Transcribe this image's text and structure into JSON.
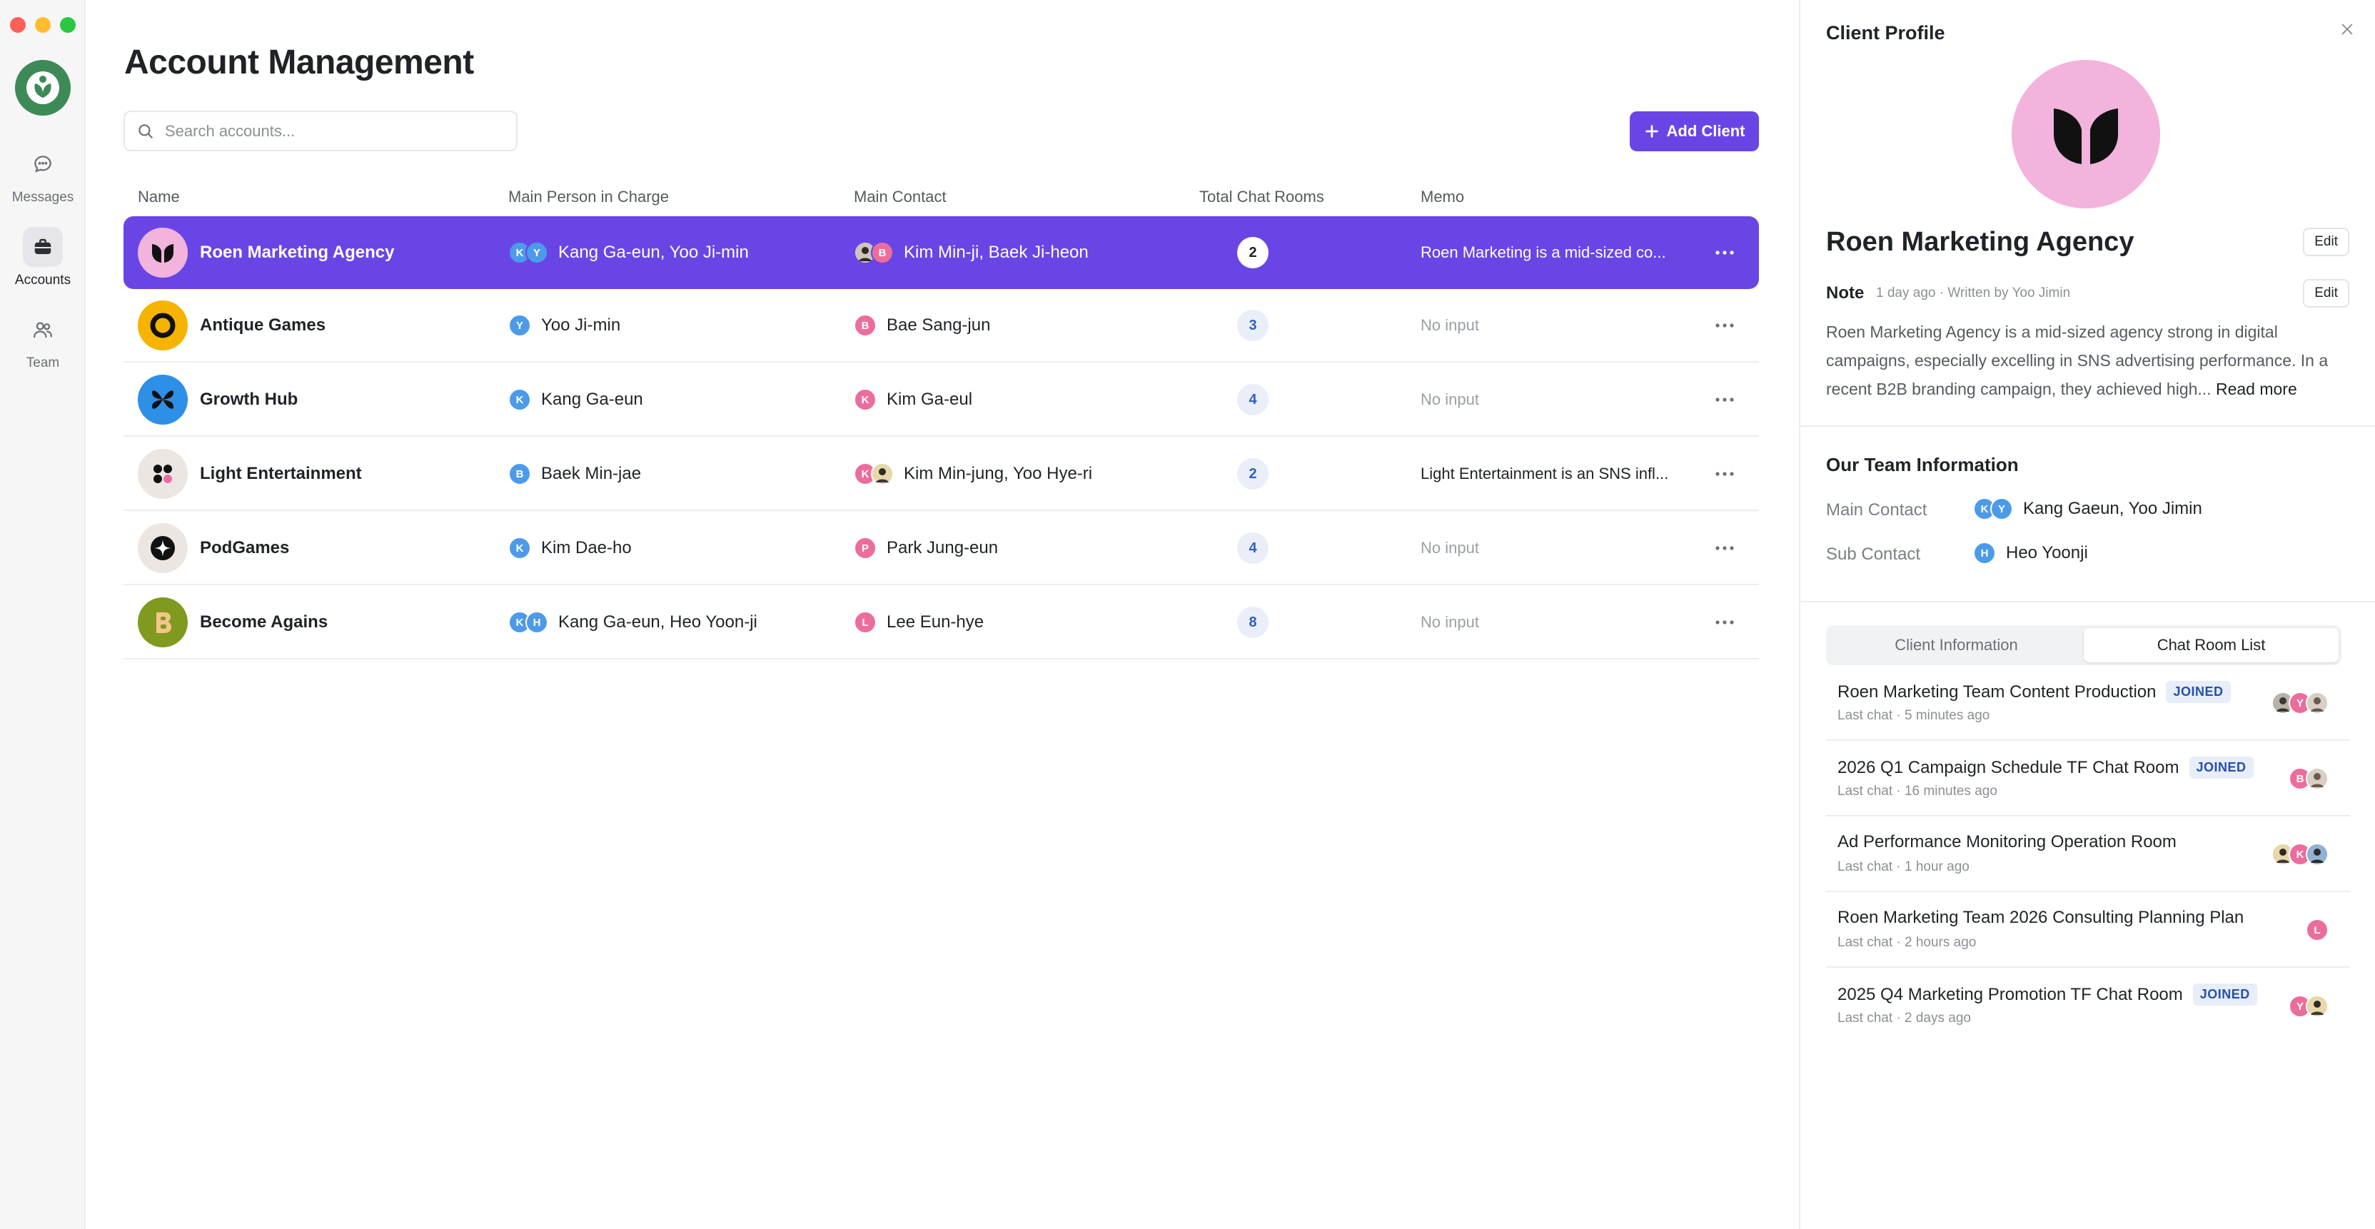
{
  "rail": {
    "items": [
      {
        "label": "Messages",
        "icon": "chat-bubble-icon"
      },
      {
        "label": "Accounts",
        "icon": "briefcase-icon"
      },
      {
        "label": "Team",
        "icon": "people-icon"
      }
    ]
  },
  "main": {
    "title": "Account Management",
    "search_placeholder": "Search accounts...",
    "add_button": "Add Client",
    "columns": [
      "Name",
      "Main Person in Charge",
      "Main Contact",
      "Total Chat Rooms",
      "Memo"
    ],
    "rows": [
      {
        "name": "Roen Marketing Agency",
        "person_initials": [
          "K",
          "Y"
        ],
        "person": "Kang Ga-eun, Yoo Ji-min",
        "contact_initials": [
          "",
          "B"
        ],
        "contact": "Kim Min-ji, Baek Ji-heon",
        "rooms": "2",
        "memo": "Roen Marketing is a mid-sized co..."
      },
      {
        "name": "Antique Games",
        "person_initials": [
          "Y"
        ],
        "person": "Yoo Ji-min",
        "contact_initials": [
          "B"
        ],
        "contact": "Bae Sang-jun",
        "rooms": "3",
        "memo": "No input"
      },
      {
        "name": "Growth Hub",
        "person_initials": [
          "K"
        ],
        "person": "Kang Ga-eun",
        "contact_initials": [
          "K"
        ],
        "contact": "Kim Ga-eul",
        "rooms": "4",
        "memo": "No input"
      },
      {
        "name": "Light Entertainment",
        "person_initials": [
          "B"
        ],
        "person": "Baek Min-jae",
        "contact_initials": [
          "K",
          ""
        ],
        "contact": "Kim Min-jung, Yoo Hye-ri",
        "rooms": "2",
        "memo": "Light Entertainment is an SNS infl..."
      },
      {
        "name": "PodGames",
        "person_initials": [
          "K"
        ],
        "person": "Kim Dae-ho",
        "contact_initials": [
          "P"
        ],
        "contact": "Park Jung-eun",
        "rooms": "4",
        "memo": "No input"
      },
      {
        "name": "Become Agains",
        "person_initials": [
          "K",
          "H"
        ],
        "person": "Kang Ga-eun, Heo Yoon-ji",
        "contact_initials": [
          "L"
        ],
        "contact": "Lee Eun-hye",
        "rooms": "8",
        "memo": "No input"
      }
    ]
  },
  "panel": {
    "title": "Client Profile",
    "client_name": "Roen Marketing Agency",
    "edit_label": "Edit",
    "note_label": "Note",
    "note_meta": "1 day ago · Written by Yoo Jimin",
    "note_text": "Roen Marketing Agency is a mid-sized agency strong in digital campaigns, especially excelling in SNS advertising performance. In a recent B2B branding campaign, they achieved high...",
    "read_more": "Read more",
    "team_section": "Our Team Information",
    "main_contact_label": "Main Contact",
    "main_contact_initials": [
      "K",
      "Y"
    ],
    "main_contact": "Kang Gaeun, Yoo Jimin",
    "sub_contact_label": "Sub Contact",
    "sub_contact_initials": [
      "H"
    ],
    "sub_contact": "Heo Yoonji",
    "tabs": [
      "Client Information",
      "Chat Room List"
    ],
    "rooms": [
      {
        "title": "Roen Marketing Team Content Production",
        "joined": "JOINED",
        "sub": "Last chat · 5 minutes ago",
        "avatars": [
          "",
          "Y",
          ""
        ]
      },
      {
        "title": "2026 Q1 Campaign Schedule TF Chat Room",
        "joined": "JOINED",
        "sub": "Last chat · 16 minutes ago",
        "avatars": [
          "B",
          ""
        ]
      },
      {
        "title": "Ad Performance Monitoring Operation Room",
        "joined": "",
        "sub": "Last chat · 1 hour ago",
        "avatars": [
          "",
          "K",
          ""
        ]
      },
      {
        "title": "Roen Marketing Team 2026 Consulting Planning Plan",
        "joined": "",
        "sub": "Last chat · 2 hours ago",
        "avatars": [
          "L"
        ]
      },
      {
        "title": "2025 Q4 Marketing Promotion TF Chat Room",
        "joined": "JOINED",
        "sub": "Last chat · 2 days ago",
        "avatars": [
          "Y",
          ""
        ]
      }
    ]
  },
  "colors": {
    "accent": "#6a45e6",
    "avatar_blue": "#4d9be8",
    "avatar_pink": "#ec6d9c",
    "joined_badge": "#2750a8"
  }
}
